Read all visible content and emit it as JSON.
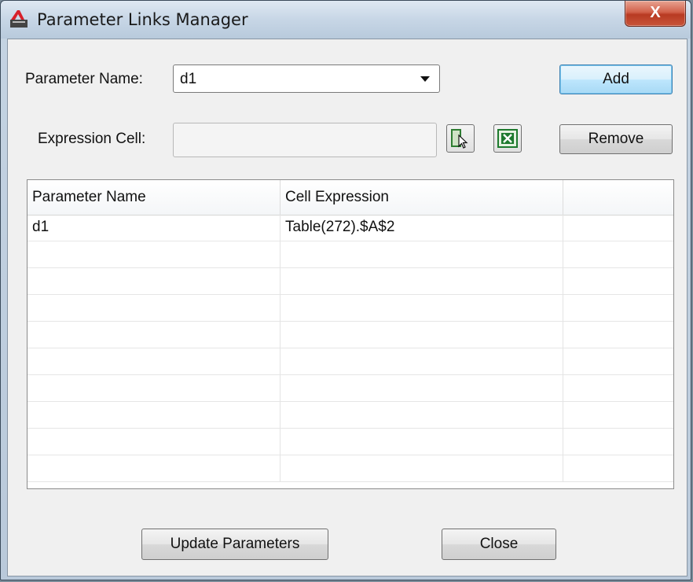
{
  "window": {
    "title": "Parameter Links Manager",
    "close_label": "X"
  },
  "form": {
    "parameter_name_label": "Parameter Name:",
    "parameter_name_value": "d1",
    "expression_cell_label": "Expression Cell:",
    "expression_cell_value": ""
  },
  "buttons": {
    "add": "Add",
    "remove": "Remove",
    "update_parameters": "Update Parameters",
    "close": "Close"
  },
  "icons": {
    "select_cell": "select-cell-icon",
    "excel": "excel-icon"
  },
  "table": {
    "headers": [
      "Parameter Name",
      "Cell Expression",
      ""
    ],
    "rows": [
      [
        "d1",
        "Table(272).$A$2",
        ""
      ],
      [
        "",
        "",
        ""
      ],
      [
        "",
        "",
        ""
      ],
      [
        "",
        "",
        ""
      ],
      [
        "",
        "",
        ""
      ],
      [
        "",
        "",
        ""
      ],
      [
        "",
        "",
        ""
      ],
      [
        "",
        "",
        ""
      ],
      [
        "",
        "",
        ""
      ],
      [
        "",
        "",
        ""
      ]
    ]
  },
  "colors": {
    "accent_button_border": "#3c7fb1",
    "close_button": "#c8553a",
    "excel_green": "#1e7a2e"
  }
}
